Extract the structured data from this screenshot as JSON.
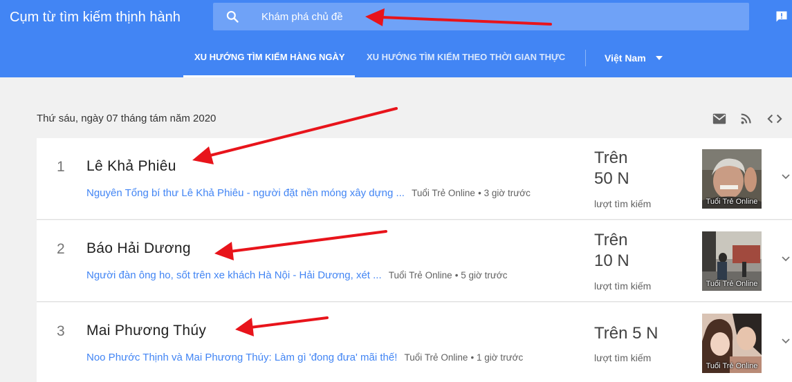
{
  "header": {
    "app_title": "Cụm từ tìm kiếm thịnh hành",
    "search_placeholder": "Khám phá chủ đề",
    "tabs": [
      {
        "label": "XU HƯỚNG TÌM KIẾM HÀNG NGÀY",
        "active": true
      },
      {
        "label": "XU HƯỚNG TÌM KIẾM THEO THỜI GIAN THỰC",
        "active": false
      }
    ],
    "country": "Việt Nam"
  },
  "date_label": "Thứ sáu, ngày 07 tháng tám năm 2020",
  "toolbar_icons": [
    "mail-icon",
    "rss-icon",
    "embed-code-icon"
  ],
  "trends": [
    {
      "rank": "1",
      "title": "Lê Khả Phiêu",
      "article": "Nguyên Tổng bí thư Lê Khả Phiêu - người đặt nền móng xây dựng ...",
      "source": "Tuổi Trẻ Online",
      "time": "3 giờ trước",
      "count_line1": "Trên",
      "count_line2": "50 N",
      "count_label": "lượt tìm kiếm",
      "thumb_source": "Tuổi Trẻ Online"
    },
    {
      "rank": "2",
      "title": "Báo Hải Dương",
      "article": "Người đàn ông ho, sốt trên xe khách Hà Nội - Hải Dương, xét ...",
      "source": "Tuổi Trẻ Online",
      "time": "5 giờ trước",
      "count_line1": "Trên",
      "count_line2": "10 N",
      "count_label": "lượt tìm kiếm",
      "thumb_source": "Tuổi Trẻ Online"
    },
    {
      "rank": "3",
      "title": "Mai Phương Thúy",
      "article": "Noo Phước Thịnh và Mai Phương Thúy: Làm gì 'đong đưa' mãi thế!",
      "source": "Tuổi Trẻ Online",
      "time": "1 giờ trước",
      "count_line1": "Trên 5 N",
      "count_line2": "",
      "count_label": "lượt tìm kiếm",
      "thumb_source": "Tuổi Trẻ Online"
    }
  ],
  "colors": {
    "header_blue": "#4285f4",
    "link_blue": "#4285f4",
    "annotation_red": "#e8141b"
  }
}
